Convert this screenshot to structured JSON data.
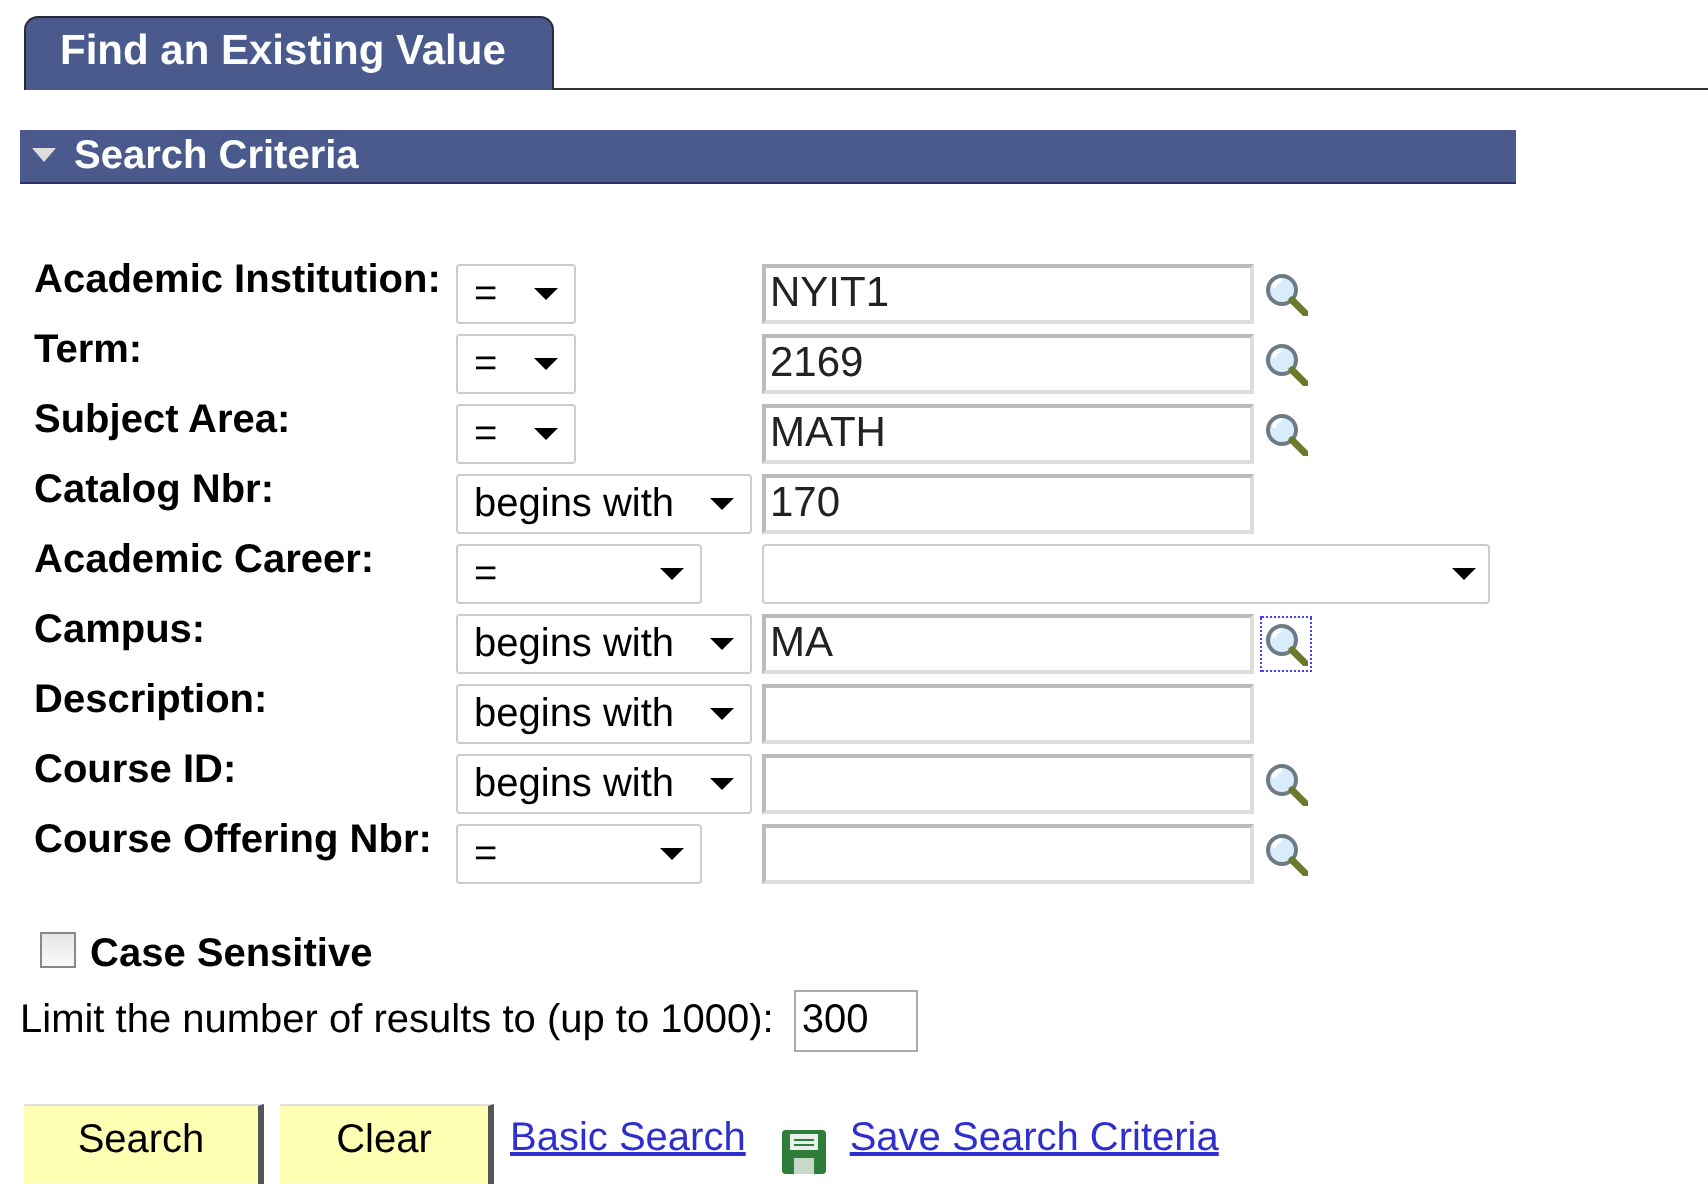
{
  "tab": {
    "label": "Find an Existing Value",
    "selected": true
  },
  "section": {
    "title": "Search Criteria",
    "expanded": true
  },
  "fields": [
    {
      "label": "Academic Institution:",
      "operator": {
        "value": "=",
        "kind": "short"
      },
      "input": {
        "kind": "text",
        "value": "NYIT1"
      },
      "lookup": {
        "focused": false
      }
    },
    {
      "label": "Term:",
      "operator": {
        "value": "=",
        "kind": "short"
      },
      "input": {
        "kind": "text",
        "value": "2169"
      },
      "lookup": {
        "focused": false
      }
    },
    {
      "label": "Subject Area:",
      "operator": {
        "value": "=",
        "kind": "short"
      },
      "input": {
        "kind": "text",
        "value": "MATH"
      },
      "lookup": {
        "focused": false
      }
    },
    {
      "label": "Catalog Nbr:",
      "operator": {
        "value": "begins with",
        "kind": "long"
      },
      "input": {
        "kind": "text",
        "value": "170"
      }
    },
    {
      "label": "Academic Career:",
      "operator": {
        "value": "=",
        "kind": "medium"
      },
      "input": {
        "kind": "dropdown"
      }
    },
    {
      "label": "Campus:",
      "operator": {
        "value": "begins with",
        "kind": "long"
      },
      "input": {
        "kind": "text",
        "value": "MA"
      },
      "lookup": {
        "focused": true
      }
    },
    {
      "label": "Description:",
      "operator": {
        "value": "begins with",
        "kind": "long"
      },
      "input": {
        "kind": "text"
      }
    },
    {
      "label": "Course ID:",
      "operator": {
        "value": "begins with",
        "kind": "long"
      },
      "input": {
        "kind": "text"
      },
      "lookup": {
        "focused": false
      }
    },
    {
      "label": "Course Offering Nbr:",
      "operator": {
        "value": "=",
        "kind": "medium"
      },
      "input": {
        "kind": "text"
      },
      "lookup": {
        "focused": false
      }
    }
  ],
  "case_sensitive": {
    "label": "Case Sensitive",
    "checked": false
  },
  "limit": {
    "label": "Limit the number of results to (up to 1000):",
    "value": "300"
  },
  "buttons": [
    {
      "label": "Search"
    },
    {
      "label": "Clear"
    }
  ],
  "links": [
    {
      "label": "Basic Search",
      "icon": false
    },
    {
      "label": "Save Search Criteria",
      "icon": true
    }
  ]
}
